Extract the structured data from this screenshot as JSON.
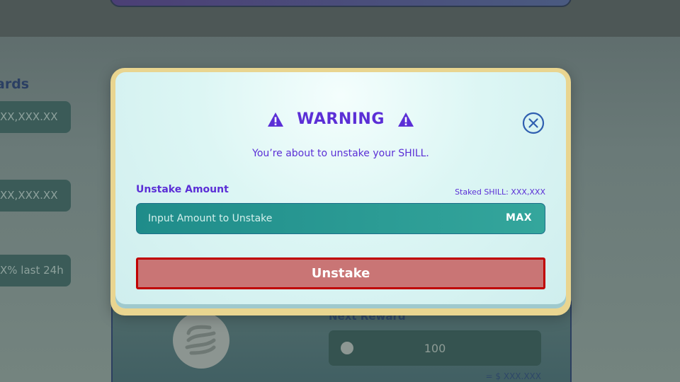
{
  "background": {
    "rewards_title": "ards",
    "stats": [
      "XX,XXX.XX",
      "XX,XXX.XX",
      "X% last 24h"
    ],
    "next_reward_label": "Next Reward",
    "next_reward_value": "100",
    "usd_value": "= $ XXX.XXX"
  },
  "modal": {
    "title": "WARNING",
    "subtitle": "You’re about to unstake your SHILL.",
    "unstake_label": "Unstake Amount",
    "staked_info": "Staked SHILL: XXX,XXX",
    "input_placeholder": "Input Amount to Unstake",
    "max_label": "MAX",
    "unstake_button": "Unstake"
  },
  "icons": {
    "warning": "warning-triangle-icon",
    "close": "close-circle-icon",
    "token": "shill-logo-icon"
  },
  "colors": {
    "accent": "#5b2fd6",
    "modal_border": "#e9d590",
    "input_bg": "#1f8c8a",
    "danger_border": "#c00000",
    "danger_fill": "#c97575"
  }
}
